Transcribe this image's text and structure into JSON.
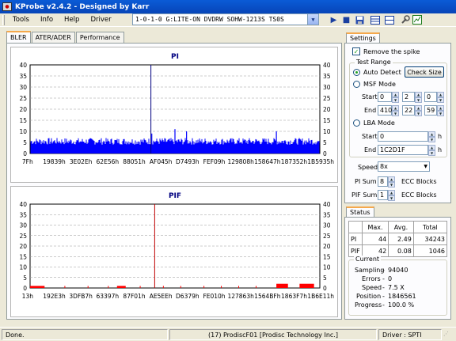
{
  "window": {
    "title": "KProbe v2.4.2 - Designed by Karr"
  },
  "menu": [
    "Tools",
    "Info",
    "Help",
    "Driver"
  ],
  "drive": {
    "selected": "1-0-1-0 G:LITE-ON DVDRW SOHW-1213S TS0S"
  },
  "toolbar": [
    "play-icon",
    "stop-icon",
    "save-icon",
    "layout-1-icon",
    "layout-2-icon",
    "settings-tool-icon",
    "chart-icon"
  ],
  "tabs": [
    "BLER",
    "ATER/ADER",
    "Performance"
  ],
  "active_tab": "BLER",
  "chart_data": [
    {
      "type": "bar",
      "title": "PI",
      "color": "#0000ff",
      "ylim": [
        0,
        40
      ],
      "yticks": [
        0,
        5,
        10,
        15,
        20,
        25,
        30,
        35,
        40
      ],
      "xlabels": [
        "7Fh",
        "19839h",
        "3E02Eh",
        "62E56h",
        "88051h",
        "AF045h",
        "D7493h",
        "FEF09h",
        "129808h",
        "158647h",
        "187352h",
        "1B5935h"
      ],
      "baseline": [
        4,
        6
      ],
      "spikes": [
        {
          "pos": 0.42,
          "value": 9
        },
        {
          "pos": 0.5,
          "value": 11
        },
        {
          "pos": 0.54,
          "value": 10
        },
        {
          "pos": 0.85,
          "value": 10
        }
      ],
      "marker": {
        "pos": 0.417,
        "value": 44,
        "color": "#000080"
      }
    },
    {
      "type": "bar",
      "title": "PIF",
      "color": "#ff0000",
      "ylim": [
        0,
        40
      ],
      "yticks": [
        0,
        5,
        10,
        15,
        20,
        25,
        30,
        35,
        40
      ],
      "xlabels": [
        "13h",
        "192E3h",
        "3DFB7h",
        "63397h",
        "87F01h",
        "AE5EEh",
        "D6379h",
        "FE010h",
        "127863h",
        "1564BFh",
        "1863F7h",
        "1B6E11h"
      ],
      "segments": [
        {
          "from": 0.0,
          "to": 0.05,
          "value": 1
        },
        {
          "from": 0.3,
          "to": 0.33,
          "value": 1
        },
        {
          "from": 0.85,
          "to": 0.89,
          "value": 2
        },
        {
          "from": 0.93,
          "to": 0.98,
          "value": 2
        }
      ],
      "marker": {
        "pos": 0.43,
        "value": 42,
        "color": "#c00000"
      }
    }
  ],
  "settings": {
    "tab": "Settings",
    "remove_spike": "Remove the spike",
    "test_range": "Test Range",
    "auto_detect": "Auto Detect",
    "check_size": "Check Size",
    "msf_mode": "MSF Mode",
    "start_label": "Start",
    "end_label": "End",
    "msf_start": [
      "0",
      "2",
      "0"
    ],
    "msf_end": [
      "410",
      "22",
      "59"
    ],
    "lba_mode": "LBA Mode",
    "lba_start": "0",
    "lba_end": "1C2D1F",
    "h": "h",
    "speed_label": "Speed",
    "speed": "8x",
    "pi_sum_label": "PI Sum",
    "pi_sum": "8",
    "pif_sum_label": "PIF Sum",
    "pif_sum": "1",
    "ecc": "ECC Blocks"
  },
  "status": {
    "tab": "Status",
    "headers": [
      "",
      "Max.",
      "Avg.",
      "Total"
    ],
    "rows": [
      [
        "PI",
        "44",
        "2.49",
        "34243"
      ],
      [
        "PIF",
        "42",
        "0.08",
        "1046"
      ]
    ],
    "current_label": "Current",
    "sampling_label": "Sampling",
    "sampling": "94040",
    "errors_label": "Errors",
    "errors": "0",
    "speed_label": "Speed",
    "speed": "7.5  X",
    "position_label": "Position",
    "position": "1846561",
    "progress_label": "Progress",
    "progress": "100.0 %"
  },
  "statusbar": {
    "left": "Done.",
    "center": "(17) ProdiscF01 [Prodisc Technology Inc.]",
    "right": "Driver : SPTI"
  }
}
